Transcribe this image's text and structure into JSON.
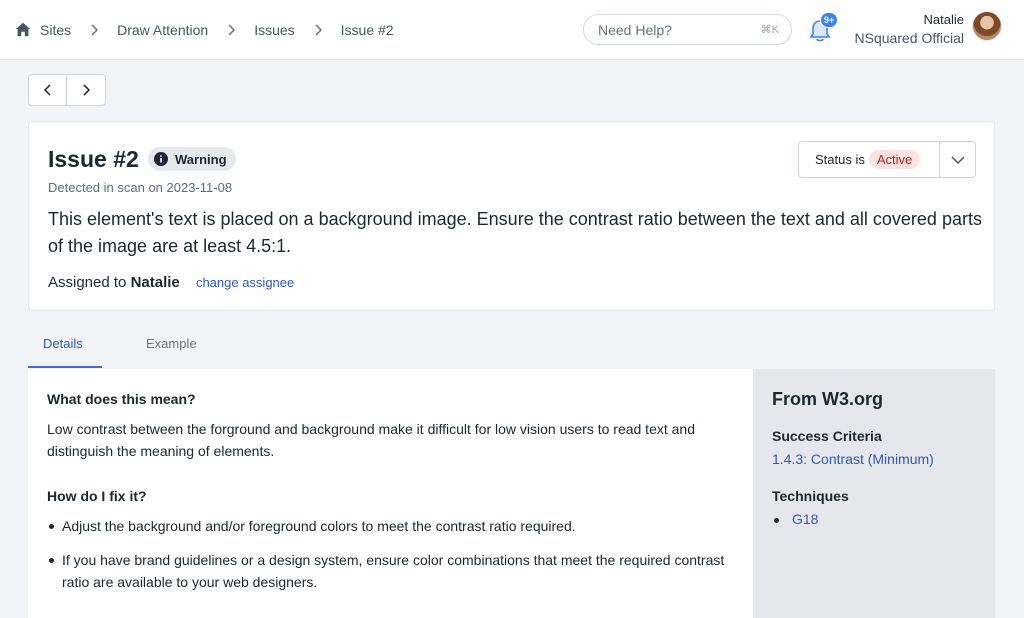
{
  "breadcrumb": {
    "items": [
      "Sites",
      "Draw Attention",
      "Issues",
      "Issue #2"
    ]
  },
  "help": {
    "placeholder": "Need Help?",
    "shortcut": "⌘K"
  },
  "notifications": {
    "badge": "9+"
  },
  "user": {
    "name": "Natalie",
    "org": "NSquared Official"
  },
  "issue": {
    "title": "Issue #2",
    "severity": "Warning",
    "detected": "Detected in scan on 2023-11-08",
    "description": "This element's text is placed on a background image. Ensure the contrast ratio between the text and all covered parts of the image are at least 4.5:1.",
    "assigned_prefix": "Assigned to",
    "assignee": "Natalie",
    "change_assignee": "change assignee",
    "status_label": "Status is",
    "status_value": "Active"
  },
  "tabs": [
    {
      "label": "Details",
      "active": true
    },
    {
      "label": "Example",
      "active": false
    }
  ],
  "details": {
    "q1": "What does this mean?",
    "a1": "Low contrast between the forground and background make it difficult for low vision users to read text and distinguish the meaning of elements.",
    "q2": "How do I fix it?",
    "fixes": [
      "Adjust the background and/or foreground colors to meet the contrast ratio required.",
      "If you have brand guidelines or a design system, ensure color combinations that meet the required contrast ratio are available to your web designers."
    ]
  },
  "w3": {
    "title": "From W3.org",
    "criteria_heading": "Success Criteria",
    "criteria_link": "1.4.3: Contrast (Minimum)",
    "techniques_heading": "Techniques",
    "techniques": [
      "G18"
    ]
  },
  "colors": {
    "accent": "#2f5bb5",
    "status_active_bg": "#fde2e2",
    "status_active_text": "#b42323"
  }
}
